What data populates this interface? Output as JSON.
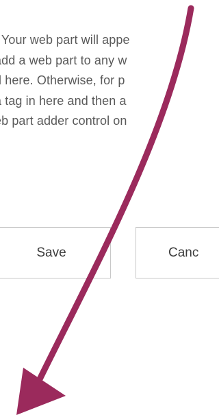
{
  "description": {
    "lines": [
      ". Your web part will appe",
      "add a web part to any w",
      "d here. Otherwise, for p",
      "a tag in here and then a",
      "eb part adder control on"
    ]
  },
  "actions": {
    "save_label": "Save",
    "cancel_label": "Canc"
  },
  "annotation": {
    "arrow_color": "#9b2a5c"
  }
}
